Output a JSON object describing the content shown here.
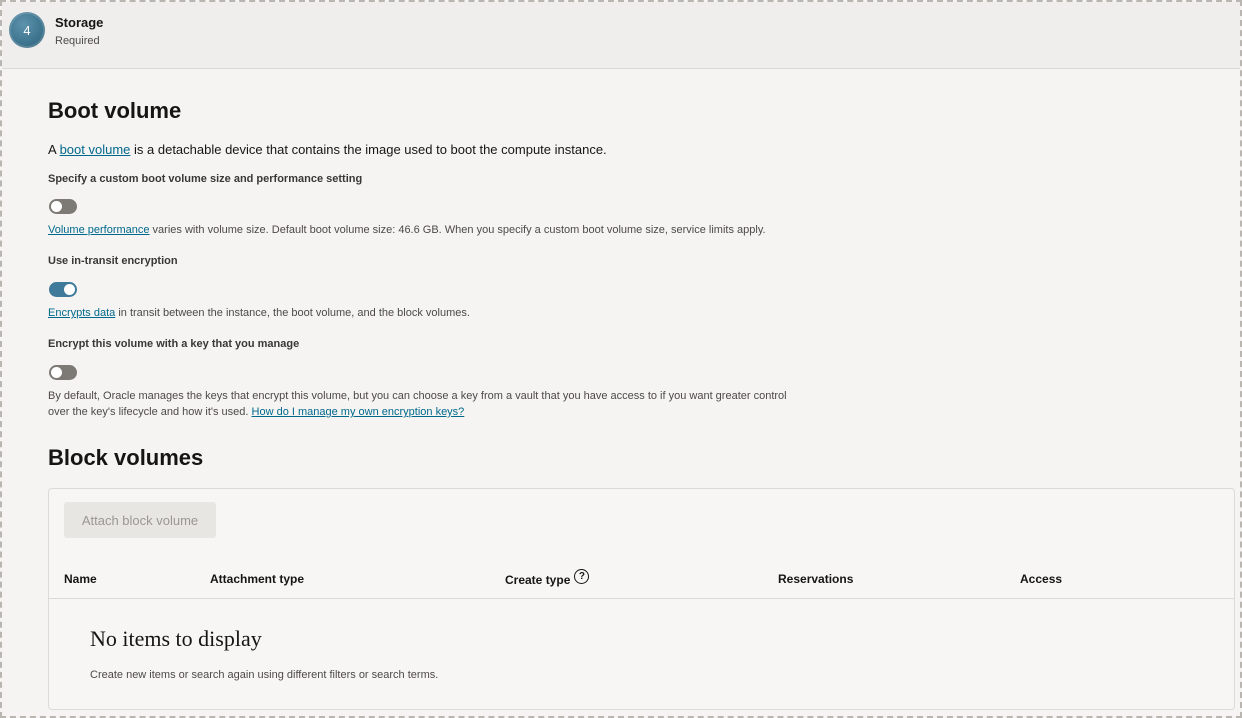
{
  "step": {
    "number": "4",
    "title": "Storage",
    "subtitle": "Required"
  },
  "boot_volume": {
    "title": "Boot volume",
    "intro_prefix": "A ",
    "intro_link": "boot volume",
    "intro_suffix": " is a detachable device that contains the image used to boot the compute instance.",
    "custom_size": {
      "label": "Specify a custom boot volume size and performance setting",
      "enabled": false,
      "help_link": "Volume performance",
      "help_text": " varies with volume size. Default boot volume size: 46.6 GB. When you specify a custom boot volume size, service limits apply."
    },
    "in_transit": {
      "label": "Use in-transit encryption",
      "enabled": true,
      "help_link": "Encrypts data",
      "help_text": " in transit between the instance, the boot volume, and the block volumes."
    },
    "own_key": {
      "label": "Encrypt this volume with a key that you manage",
      "enabled": false,
      "help_text": "By default, Oracle manages the keys that encrypt this volume, but you can choose a key from a vault that you have access to if you want greater control over the key's lifecycle and how it's used. ",
      "help_link": "How do I manage my own encryption keys?"
    }
  },
  "block_volumes": {
    "title": "Block volumes",
    "attach_label": "Attach block volume",
    "columns": [
      "Name",
      "Attachment type",
      "Create type",
      "Reservations",
      "Access"
    ],
    "empty_title": "No items to display",
    "empty_subtitle": "Create new items or search again using different filters or search terms."
  },
  "icons": {
    "help": "question-circle-icon"
  }
}
